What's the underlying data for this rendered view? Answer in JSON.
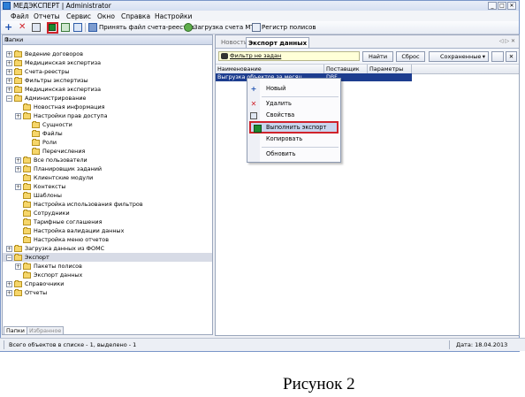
{
  "window": {
    "title": "МЕДЭКСПЕРТ | Administrator",
    "controls": {
      "minimize": "_",
      "maximize": "□",
      "close": "✕"
    }
  },
  "menu": [
    "Файл",
    "Отчеты",
    "Сервис",
    "Окно",
    "Справка",
    "Настройки"
  ],
  "toolbar": {
    "add_symbol": "+",
    "delete_symbol": "✕",
    "accept_invoice_label": "Принять файл счета-реестра",
    "upload_mtr_label": "Загрузка счета МТР",
    "policy_register_label": "Регистр полисов"
  },
  "left_pane": {
    "title": "Папки",
    "pin": "⇕",
    "tree": [
      {
        "label": "Ведение договоров",
        "expander": "+",
        "selected": false
      },
      {
        "label": "Медицинская экспертиза",
        "expander": "+",
        "selected": false
      },
      {
        "label": "Счета-реестры",
        "expander": "+",
        "selected": false
      },
      {
        "label": "Фильтры экспертизы",
        "expander": "+",
        "selected": false
      },
      {
        "label": "Медицинская экспертиза",
        "expander": "+",
        "selected": false
      },
      {
        "label": "Администрирование",
        "expander": "−",
        "selected": false
      },
      {
        "label": "Новостная информация",
        "expander": "",
        "selected": false
      },
      {
        "label": "Настройки прав доступа",
        "expander": "+",
        "selected": false
      },
      {
        "label": "Сущности",
        "expander": "",
        "selected": false
      },
      {
        "label": "Файлы",
        "expander": "",
        "selected": false
      },
      {
        "label": "Роли",
        "expander": "",
        "selected": false
      },
      {
        "label": "Перечисления",
        "expander": "",
        "selected": false
      },
      {
        "label": "Все пользователи",
        "expander": "+",
        "selected": false
      },
      {
        "label": "Планировщик заданий",
        "expander": "+",
        "selected": false
      },
      {
        "label": "Клиентские модули",
        "expander": "",
        "selected": false
      },
      {
        "label": "Контексты",
        "expander": "+",
        "selected": false
      },
      {
        "label": "Шаблоны",
        "expander": "",
        "selected": false
      },
      {
        "label": "Настройка использования фильтров",
        "expander": "",
        "selected": false
      },
      {
        "label": "Сотрудники",
        "expander": "",
        "selected": false
      },
      {
        "label": "Тарифные соглашения",
        "expander": "",
        "selected": false
      },
      {
        "label": "Настройка валидации данных",
        "expander": "",
        "selected": false
      },
      {
        "label": "Настройка меню отчетов",
        "expander": "",
        "selected": false
      },
      {
        "label": "Загрузка данных из ФОМС",
        "expander": "+",
        "selected": false
      },
      {
        "label": "Экспорт",
        "expander": "−",
        "selected": true
      },
      {
        "label": "Пакеты полисов",
        "expander": "+",
        "selected": false
      },
      {
        "label": "Экспорт данных",
        "expander": "",
        "selected": false
      },
      {
        "label": "Справочники",
        "expander": "+",
        "selected": false
      },
      {
        "label": "Отчеты",
        "expander": "+",
        "selected": false
      }
    ],
    "bottom_tabs": [
      "Папки",
      "Избранное"
    ]
  },
  "right_pane": {
    "tabs": [
      "Новости",
      "Экспорт данных"
    ],
    "tab_nav": "◁ ▷ ✕",
    "filter_label": "Фильтр не задан",
    "buttons": {
      "find": "Найти",
      "reset": "Сброс",
      "saved": "Сохраненные",
      "dropdown": "▾",
      "close": "✕"
    },
    "columns": [
      "Наименование",
      "Поставщик",
      "Параметры"
    ],
    "rows": [
      {
        "name": "Выгрузка объектов за месяц",
        "supplier": "DBF",
        "params": ""
      }
    ]
  },
  "context_menu": {
    "items": [
      {
        "label": "Новый",
        "icon": "+"
      },
      {
        "label": "Удалить",
        "icon": "✕"
      },
      {
        "label": "Свойства",
        "icon": ""
      },
      {
        "label": "Выполнить экспорт",
        "icon": ""
      },
      {
        "label": "Копировать",
        "icon": ""
      },
      {
        "label": "Обновить",
        "icon": ""
      }
    ]
  },
  "status": {
    "left": "Всего объектов в списке - 1, выделено - 1",
    "right": "Дата: 18.04.2013"
  },
  "caption": "Рисунок 2",
  "colors": {
    "highlight_border": "#d0232b",
    "selection": "#1d3d8f",
    "folder": "#f6d66a"
  }
}
